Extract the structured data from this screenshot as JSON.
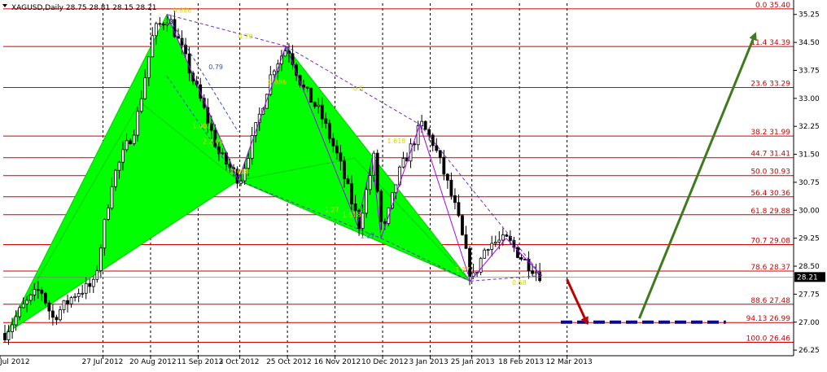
{
  "header": {
    "symbol_line": "XAGUSD,Daily  28.75 28.81 28.15 28.21"
  },
  "chart_data": {
    "type": "candlestick",
    "symbol": "XAGUSD",
    "timeframe": "Daily",
    "ohlc_last": {
      "open": 28.75,
      "high": 28.81,
      "low": 28.15,
      "close": 28.21
    },
    "current_price_label": "28.21",
    "current_price": 28.21,
    "ylim": [
      26.1,
      35.55
    ],
    "x_range": [
      0,
      100
    ],
    "y_ticks": [
      {
        "value": 35.25,
        "label": "35.25"
      },
      {
        "value": 34.5,
        "label": "34.50"
      },
      {
        "value": 33.75,
        "label": "33.75"
      },
      {
        "value": 33.0,
        "label": "33.00"
      },
      {
        "value": 32.25,
        "label": "32.25"
      },
      {
        "value": 31.5,
        "label": "31.50"
      },
      {
        "value": 30.75,
        "label": "30.75"
      },
      {
        "value": 30.0,
        "label": "30.00"
      },
      {
        "value": 29.25,
        "label": "29.25"
      },
      {
        "value": 28.5,
        "label": "28.50"
      },
      {
        "value": 27.75,
        "label": "27.75"
      },
      {
        "value": 27.0,
        "label": "27.00"
      },
      {
        "value": 26.25,
        "label": "26.25"
      }
    ],
    "x_ticks": [
      {
        "x": 0,
        "label": "Jul 2012"
      },
      {
        "x": 8,
        "label": "27 Jul 2012"
      },
      {
        "x": 16,
        "label": "20 Aug 2012"
      },
      {
        "x": 24,
        "label": "11 Sep 2012"
      },
      {
        "x": 31,
        "label": "3 Oct 2012"
      },
      {
        "x": 39,
        "label": "25 Oct 2012"
      },
      {
        "x": 47,
        "label": "16 Nov 2012"
      },
      {
        "x": 55,
        "label": "10 Dec 2012"
      },
      {
        "x": 63,
        "label": "3 Jan 2013"
      },
      {
        "x": 70,
        "label": "25 Jan 2013"
      },
      {
        "x": 78,
        "label": "18 Feb 2013"
      },
      {
        "x": 86,
        "label": "12 Mar 2013"
      }
    ],
    "fib_levels": [
      {
        "ratio": "0.0",
        "value": 35.4,
        "label": "0.0 35.40"
      },
      {
        "ratio": "11.4",
        "value": 34.39,
        "label": "11.4 34.39"
      },
      {
        "ratio": "23.6",
        "value": 33.29,
        "label": "23.6 33.29"
      },
      {
        "ratio": "38.2",
        "value": 31.99,
        "label": "38.2 31.99"
      },
      {
        "ratio": "44.7",
        "value": 31.41,
        "label": "44.7 31.41"
      },
      {
        "ratio": "50.0",
        "value": 30.93,
        "label": "50.0 30.93"
      },
      {
        "ratio": "56.4",
        "value": 30.36,
        "label": "56.4 30.36"
      },
      {
        "ratio": "61.8",
        "value": 29.88,
        "label": "61.8 29.88"
      },
      {
        "ratio": "70.7",
        "value": 29.08,
        "label": "70.7 29.08"
      },
      {
        "ratio": "78.6",
        "value": 28.37,
        "label": "78.6 28.37"
      },
      {
        "ratio": "88.6",
        "value": 27.48,
        "label": "88.6 27.48"
      },
      {
        "ratio": "94.13",
        "value": 26.99,
        "label": "94.13 26.99"
      },
      {
        "ratio": "100.0",
        "value": 26.46,
        "label": "100.0 26.46"
      }
    ],
    "harmonic_patterns": [
      {
        "points": [
          {
            "x": 0.5,
            "y": 26.7
          },
          {
            "x": 27.5,
            "y": 35.25
          },
          {
            "x": 39.5,
            "y": 30.8
          }
        ],
        "color": "#00ff00"
      },
      {
        "points": [
          {
            "x": 39.5,
            "y": 30.8
          },
          {
            "x": 47.5,
            "y": 34.4
          },
          {
            "x": 78.5,
            "y": 28.1
          }
        ],
        "color": "#00ff00"
      }
    ],
    "pattern_lines": [
      {
        "from": {
          "x": 27.5,
          "y": 35.25
        },
        "to": {
          "x": 39.5,
          "y": 30.8
        },
        "color": "#aa00ff",
        "dash": false
      },
      {
        "from": {
          "x": 39.5,
          "y": 30.8
        },
        "to": {
          "x": 47.5,
          "y": 34.4
        },
        "color": "#aa00ff",
        "dash": false
      },
      {
        "from": {
          "x": 47.5,
          "y": 34.4
        },
        "to": {
          "x": 59.5,
          "y": 29.6
        },
        "color": "#aa00ff",
        "dash": false
      },
      {
        "from": {
          "x": 59.5,
          "y": 29.6
        },
        "to": {
          "x": 62.0,
          "y": 31.4
        },
        "color": "#aa00ff",
        "dash": false
      },
      {
        "from": {
          "x": 62.0,
          "y": 31.4
        },
        "to": {
          "x": 63.5,
          "y": 29.25
        },
        "color": "#aa00ff",
        "dash": false
      },
      {
        "from": {
          "x": 63.5,
          "y": 29.25
        },
        "to": {
          "x": 70.0,
          "y": 32.3
        },
        "color": "#aa00ff",
        "dash": false
      },
      {
        "from": {
          "x": 70.0,
          "y": 32.3
        },
        "to": {
          "x": 78.5,
          "y": 28.1
        },
        "color": "#aa00ff",
        "dash": false
      },
      {
        "from": {
          "x": 78.5,
          "y": 28.1
        },
        "to": {
          "x": 84.5,
          "y": 29.25
        },
        "color": "#aa00ff",
        "dash": false
      },
      {
        "from": {
          "x": 84.5,
          "y": 29.25
        },
        "to": {
          "x": 90.5,
          "y": 28.25
        },
        "color": "#aa00ff",
        "dash": false
      },
      {
        "from": {
          "x": 27.5,
          "y": 35.25
        },
        "to": {
          "x": 47.5,
          "y": 34.4
        },
        "color": "#6b2fbf",
        "dash": true
      },
      {
        "from": {
          "x": 47.5,
          "y": 34.4
        },
        "to": {
          "x": 70.0,
          "y": 32.3
        },
        "color": "#6b2fbf",
        "dash": true
      },
      {
        "from": {
          "x": 70.0,
          "y": 32.3
        },
        "to": {
          "x": 90.5,
          "y": 28.25
        },
        "color": "#6b2fbf",
        "dash": true
      },
      {
        "from": {
          "x": 39.5,
          "y": 30.8
        },
        "to": {
          "x": 63.5,
          "y": 29.25
        },
        "color": "#6b2fbf",
        "dash": true
      },
      {
        "from": {
          "x": 63.5,
          "y": 29.25
        },
        "to": {
          "x": 78.5,
          "y": 28.1
        },
        "color": "#6b2fbf",
        "dash": true
      },
      {
        "from": {
          "x": 78.5,
          "y": 28.1
        },
        "to": {
          "x": 90.5,
          "y": 28.25
        },
        "color": "#6b2fbf",
        "dash": true
      },
      {
        "from": {
          "x": 27.5,
          "y": 33.6
        },
        "to": {
          "x": 39.5,
          "y": 30.8
        },
        "color": "#3050c0",
        "dash": true
      },
      {
        "from": {
          "x": 27.5,
          "y": 35.25
        },
        "to": {
          "x": 39.5,
          "y": 32.1
        },
        "color": "#3050c0",
        "dash": true
      }
    ],
    "pattern_labels": [
      {
        "x": 28.5,
        "y": 35.3,
        "text": "0.886",
        "color": "#d6d600"
      },
      {
        "x": 34.5,
        "y": 33.78,
        "text": "0.79",
        "color": "#3050c0"
      },
      {
        "x": 31.8,
        "y": 32.2,
        "text": "1.902",
        "color": "#d6d600"
      },
      {
        "x": 33.5,
        "y": 31.78,
        "text": "2.2.69",
        "color": "#d6d600"
      },
      {
        "x": 38.2,
        "y": 30.98,
        "text": "1.618",
        "color": "#d6d600"
      },
      {
        "x": 39.5,
        "y": 34.6,
        "text": "0.79",
        "color": "#d6d600"
      },
      {
        "x": 44.5,
        "y": 33.38,
        "text": "0.886",
        "color": "#d6d600"
      },
      {
        "x": 58.8,
        "y": 33.2,
        "text": "0.5",
        "color": "#d6d600"
      },
      {
        "x": 54.0,
        "y": 29.95,
        "text": "1.27",
        "color": "#d6d600"
      },
      {
        "x": 57.0,
        "y": 29.82,
        "text": "1.618",
        "color": "#d6d600"
      },
      {
        "x": 60.0,
        "y": 29.25,
        "text": "1.27",
        "color": "#3050c0"
      },
      {
        "x": 64.5,
        "y": 31.8,
        "text": "1.618",
        "color": "#d6d600"
      },
      {
        "x": 76.0,
        "y": 28.35,
        "text": "1.27",
        "color": "#d6d600"
      },
      {
        "x": 85.5,
        "y": 28.0,
        "text": "0.58",
        "color": "#d6d600"
      }
    ],
    "target_line": {
      "from_x": 85.5,
      "to_x": 110.5,
      "y": 27.0,
      "color": "#0a0a8a"
    },
    "arrows": [
      {
        "from": {
          "x": 92.0,
          "y": 28.15
        },
        "to": {
          "x": 95.3,
          "y": 27.0
        },
        "color": "#c00000"
      },
      {
        "from": {
          "x": 96.5,
          "y": 27.1
        },
        "to": {
          "x": 114.0,
          "y": 34.7
        },
        "color": "#3f7a1f"
      }
    ]
  }
}
